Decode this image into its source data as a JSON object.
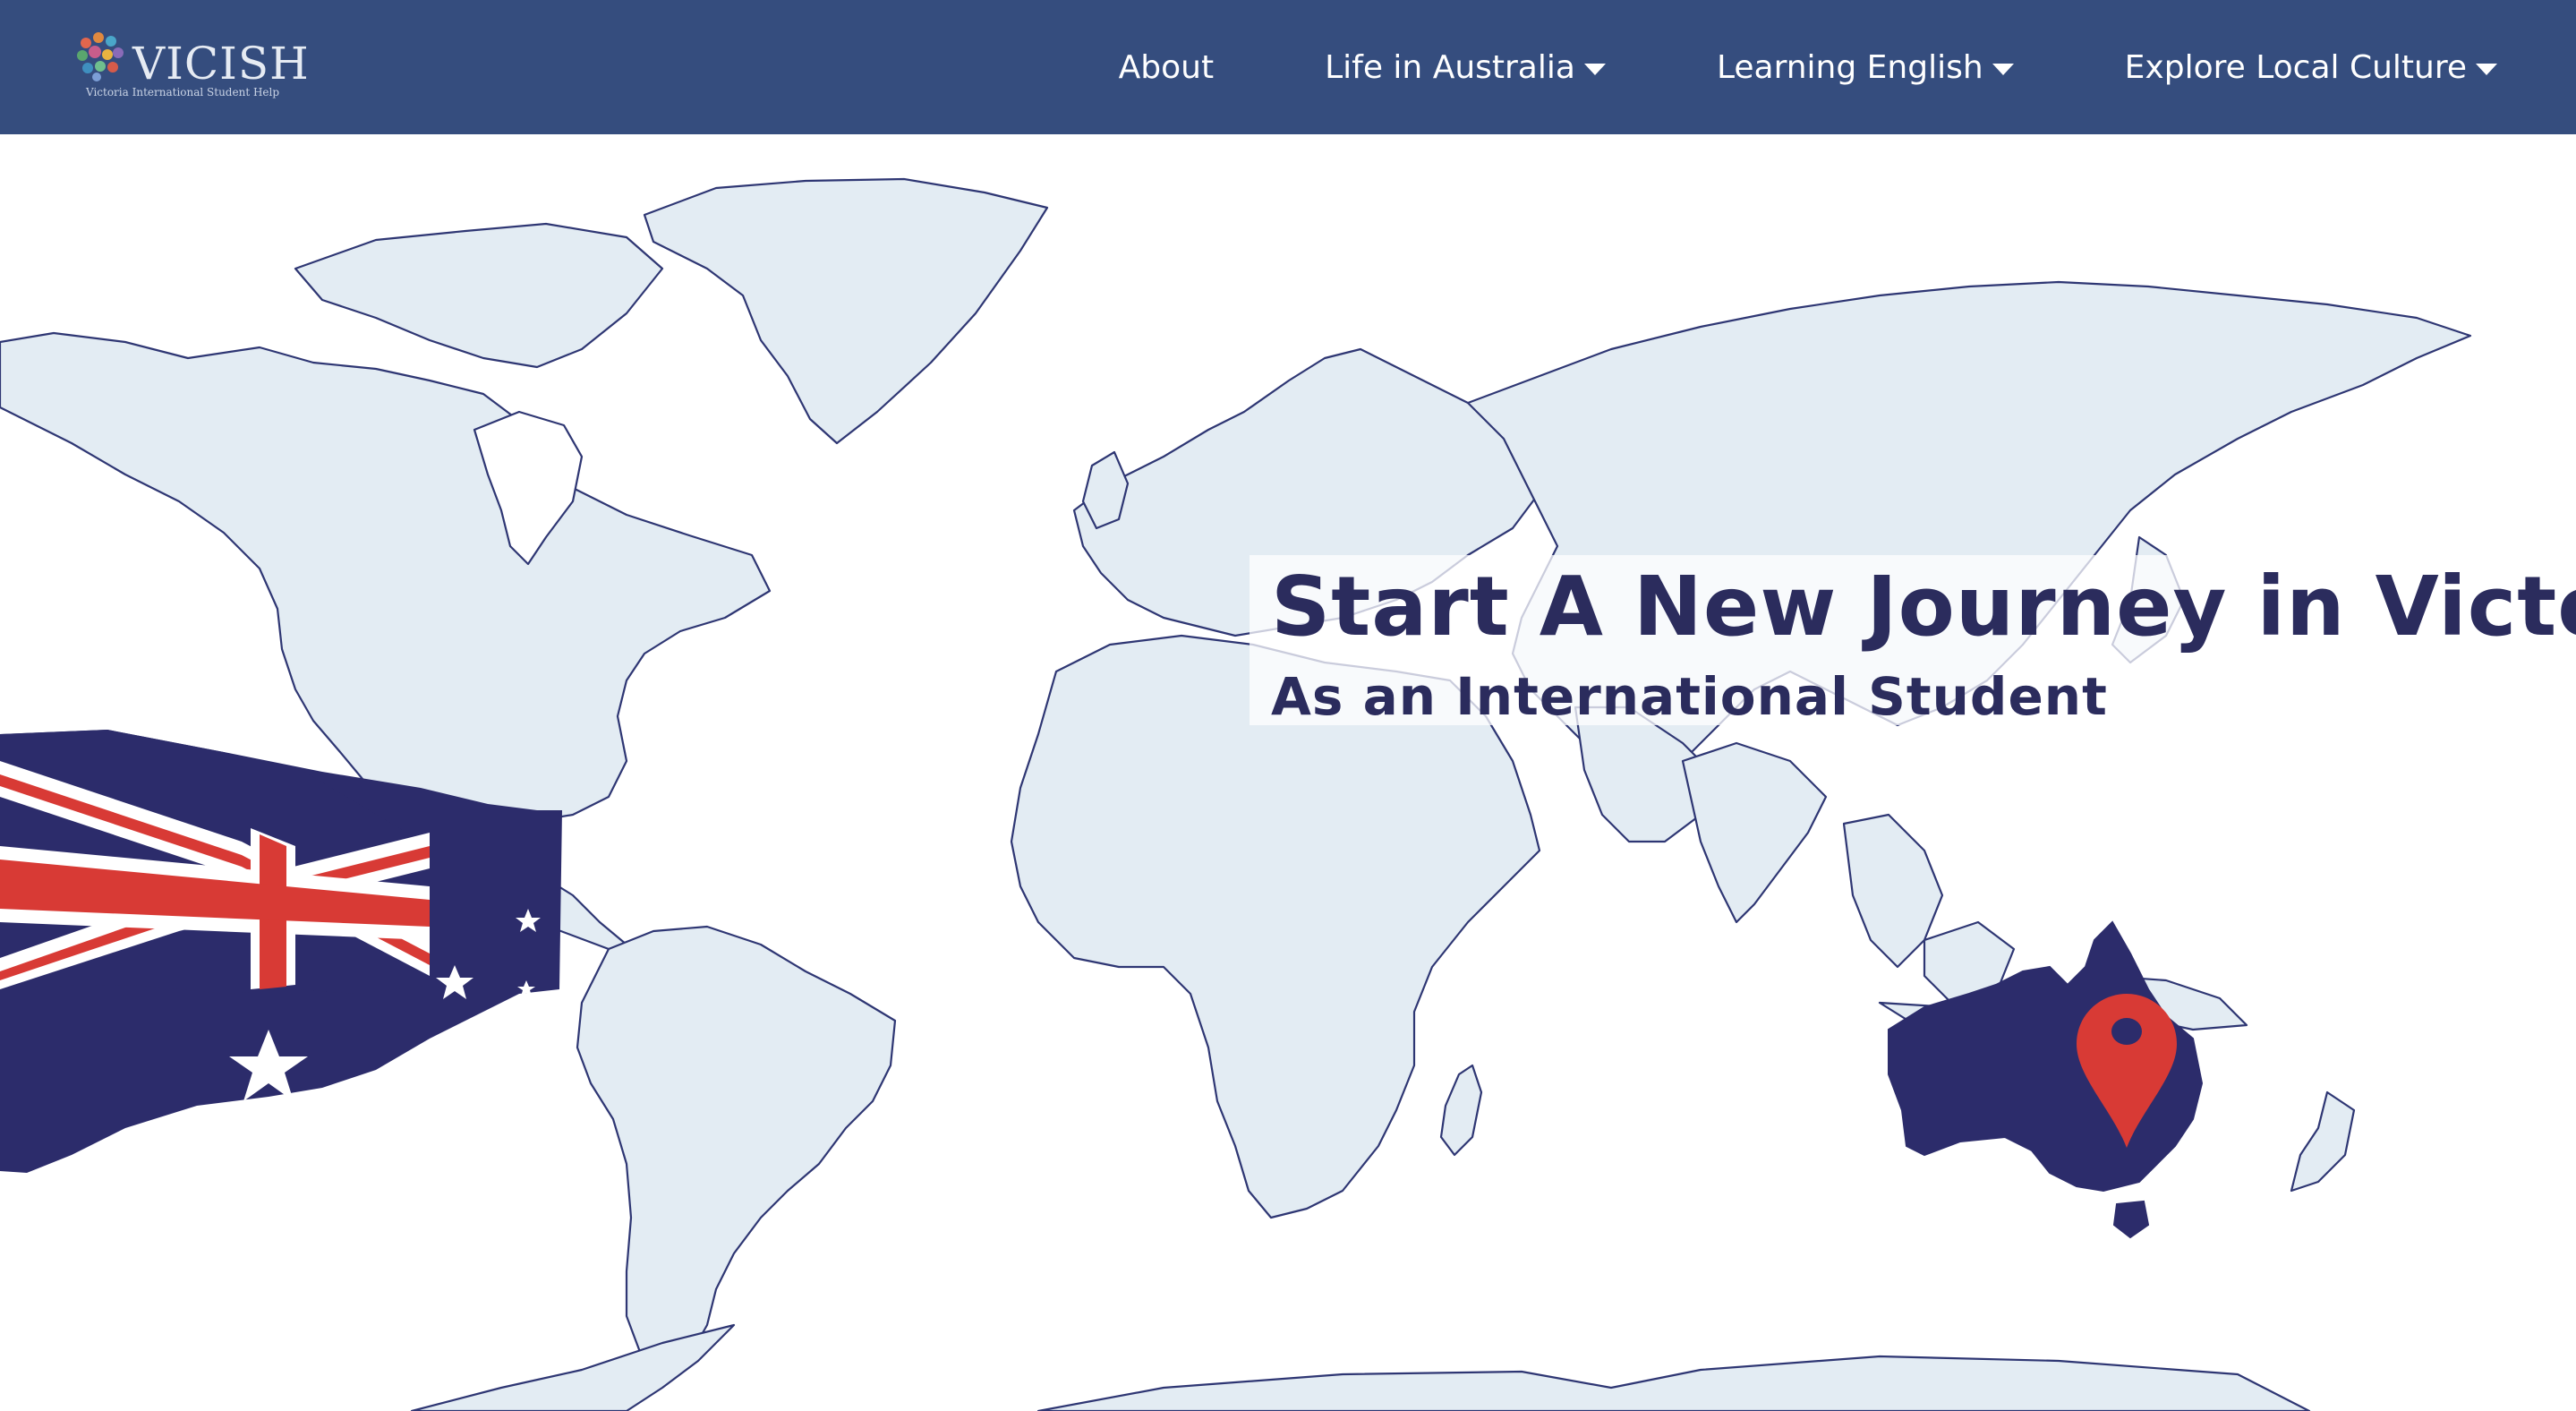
{
  "header": {
    "logo": {
      "name": "VICISH",
      "tagline": "Victoria International Student Help"
    },
    "nav": [
      {
        "label": "About",
        "has_dropdown": false
      },
      {
        "label": "Life in Australia",
        "has_dropdown": true
      },
      {
        "label": "Learning English",
        "has_dropdown": true
      },
      {
        "label": "Explore Local Culture",
        "has_dropdown": true
      }
    ]
  },
  "hero": {
    "title": "Start A New Journey in Victoria",
    "subtitle": "As an International Student"
  },
  "colors": {
    "header_bg": "#354d7e",
    "land_fill": "#e3ecf3",
    "land_stroke": "#2e3673",
    "australia": "#2c2c6b",
    "pin": "#d83a35",
    "flag_blue": "#2c2c6b",
    "flag_red": "#d83a35",
    "title_text": "#2b2c5d"
  },
  "icons": {
    "logo_mark": "colored-dots-cluster",
    "dropdown": "caret-down-icon",
    "location": "map-pin-icon",
    "flag": "australian-flag"
  }
}
